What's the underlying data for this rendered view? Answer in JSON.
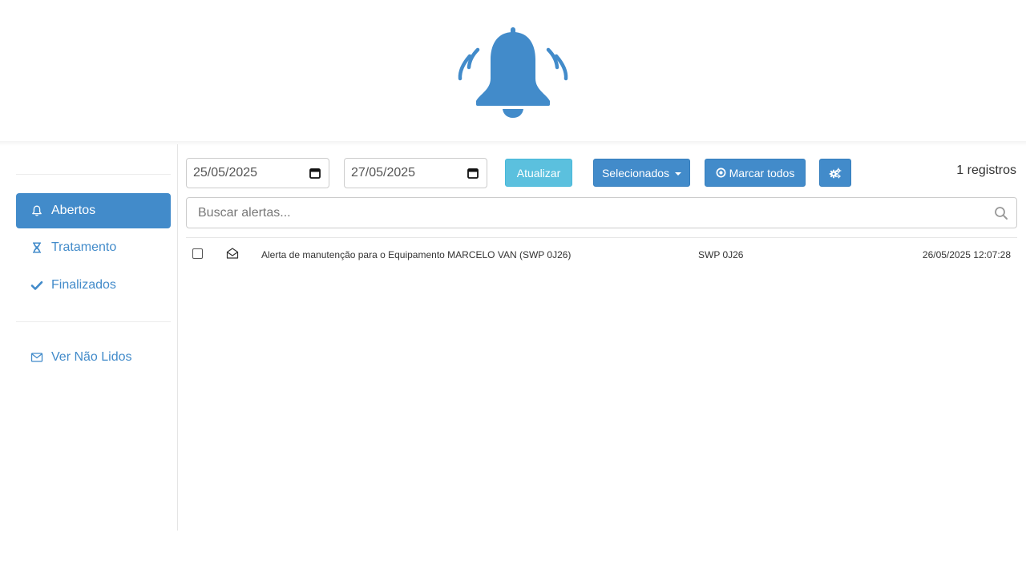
{
  "header": {
    "icon": "bell-ringing-icon",
    "color": "#428bca"
  },
  "sidebar": {
    "items": [
      {
        "label": "Abertos",
        "icon": "bell-icon",
        "active": true
      },
      {
        "label": "Tratamento",
        "icon": "hourglass-icon",
        "active": false
      },
      {
        "label": "Finalizados",
        "icon": "check-icon",
        "active": false
      }
    ],
    "unread": {
      "label": "Ver Não Lidos",
      "icon": "envelope-icon"
    }
  },
  "toolbar": {
    "date_from": "25/05/2025",
    "date_to": "27/05/2025",
    "refresh_label": "Atualizar",
    "selected_label": "Selecionados",
    "mark_all_label": "Marcar todos",
    "settings_icon": "gears-icon",
    "records_count": "1 registros"
  },
  "search": {
    "placeholder": "Buscar alertas..."
  },
  "alerts": [
    {
      "subject": "Alerta de manutenção para o Equipamento MARCELO VAN (SWP 0J26)",
      "plate": "SWP 0J26",
      "datetime": "26/05/2025 12:07:28",
      "read_icon": "envelope-open-icon"
    }
  ],
  "colors": {
    "primary": "#428bca",
    "info": "#5bc0de"
  }
}
